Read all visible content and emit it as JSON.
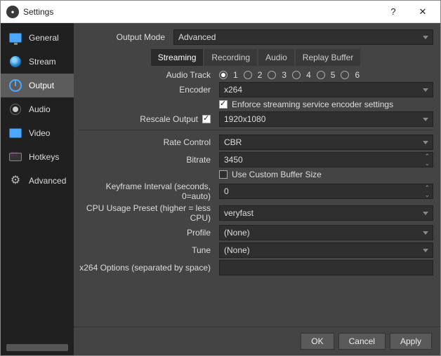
{
  "window": {
    "title": "Settings",
    "help": "?",
    "close": "✕"
  },
  "sidebar": {
    "items": [
      {
        "label": "General"
      },
      {
        "label": "Stream"
      },
      {
        "label": "Output"
      },
      {
        "label": "Audio"
      },
      {
        "label": "Video"
      },
      {
        "label": "Hotkeys"
      },
      {
        "label": "Advanced"
      }
    ]
  },
  "output": {
    "outputMode": {
      "label": "Output Mode",
      "value": "Advanced"
    },
    "tabs": {
      "streaming": "Streaming",
      "recording": "Recording",
      "audio": "Audio",
      "replay": "Replay Buffer"
    },
    "audioTrack": {
      "label": "Audio Track",
      "options": [
        "1",
        "2",
        "3",
        "4",
        "5",
        "6"
      ],
      "selected": "1"
    },
    "encoder": {
      "label": "Encoder",
      "value": "x264"
    },
    "enforce": {
      "label": "Enforce streaming service encoder settings",
      "checked": true
    },
    "rescale": {
      "label": "Rescale Output",
      "checked": true,
      "value": "1920x1080"
    },
    "rateControl": {
      "label": "Rate Control",
      "value": "CBR"
    },
    "bitrate": {
      "label": "Bitrate",
      "value": "3450"
    },
    "customBuffer": {
      "label": "Use Custom Buffer Size",
      "checked": false
    },
    "keyframe": {
      "label": "Keyframe Interval (seconds, 0=auto)",
      "value": "0"
    },
    "cpuPreset": {
      "label": "CPU Usage Preset (higher = less CPU)",
      "value": "veryfast"
    },
    "profile": {
      "label": "Profile",
      "value": "(None)"
    },
    "tune": {
      "label": "Tune",
      "value": "(None)"
    },
    "x264opts": {
      "label": "x264 Options (separated by space)",
      "value": ""
    }
  },
  "footer": {
    "ok": "OK",
    "cancel": "Cancel",
    "apply": "Apply"
  }
}
